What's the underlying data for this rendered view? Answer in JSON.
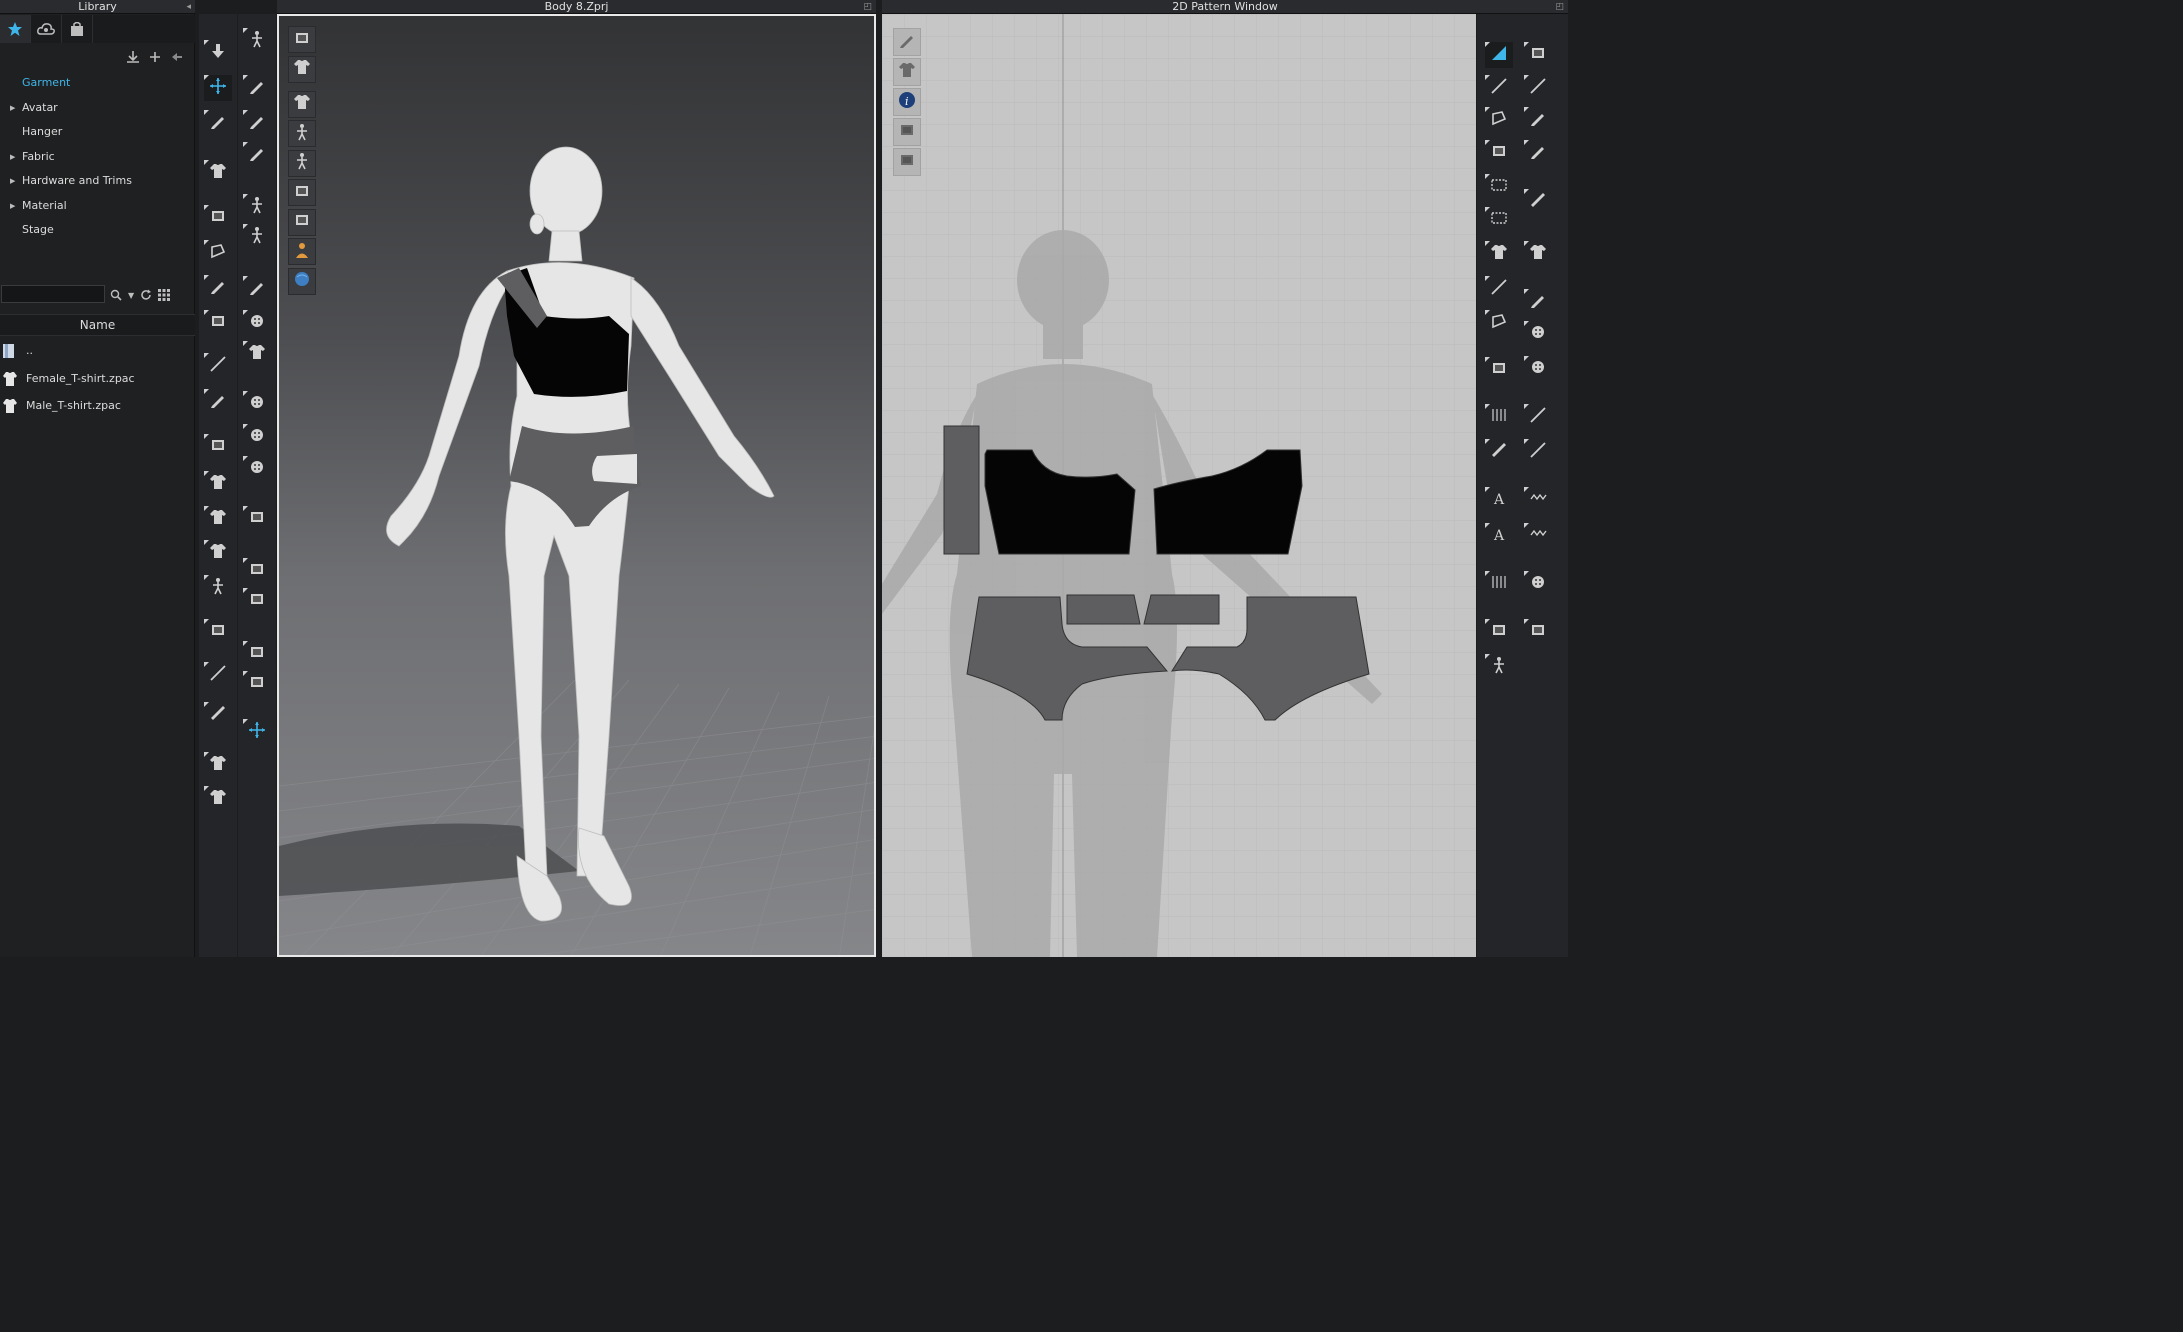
{
  "library": {
    "title": "Library",
    "tabs": [
      {
        "icon": "star-icon"
      },
      {
        "icon": "cloud-icon"
      },
      {
        "icon": "bag-icon"
      }
    ],
    "tree": [
      {
        "label": "Garment",
        "expandable": false,
        "selected": true
      },
      {
        "label": "Avatar",
        "expandable": true
      },
      {
        "label": "Hanger",
        "expandable": false
      },
      {
        "label": "Fabric",
        "expandable": true
      },
      {
        "label": "Hardware and Trims",
        "expandable": true
      },
      {
        "label": "Material",
        "expandable": true
      },
      {
        "label": "Stage",
        "expandable": false
      }
    ],
    "search_value": "",
    "name_header": "Name",
    "files": [
      {
        "label": "..",
        "icon": "folder-up-icon"
      },
      {
        "label": "Female_T-shirt.zpac",
        "icon": "tshirt-icon"
      },
      {
        "label": "Male_T-shirt.zpac",
        "icon": "tshirt-icon"
      }
    ]
  },
  "viewport3d": {
    "title": "Body 8.Zprj"
  },
  "window2d": {
    "title": "2D Pattern Window"
  },
  "colors": {
    "accent": "#3fb6ea",
    "top_fabric": "#050505",
    "bottom_fabric": "#5e5e60",
    "pattern_bg": "#c6c6c6"
  }
}
